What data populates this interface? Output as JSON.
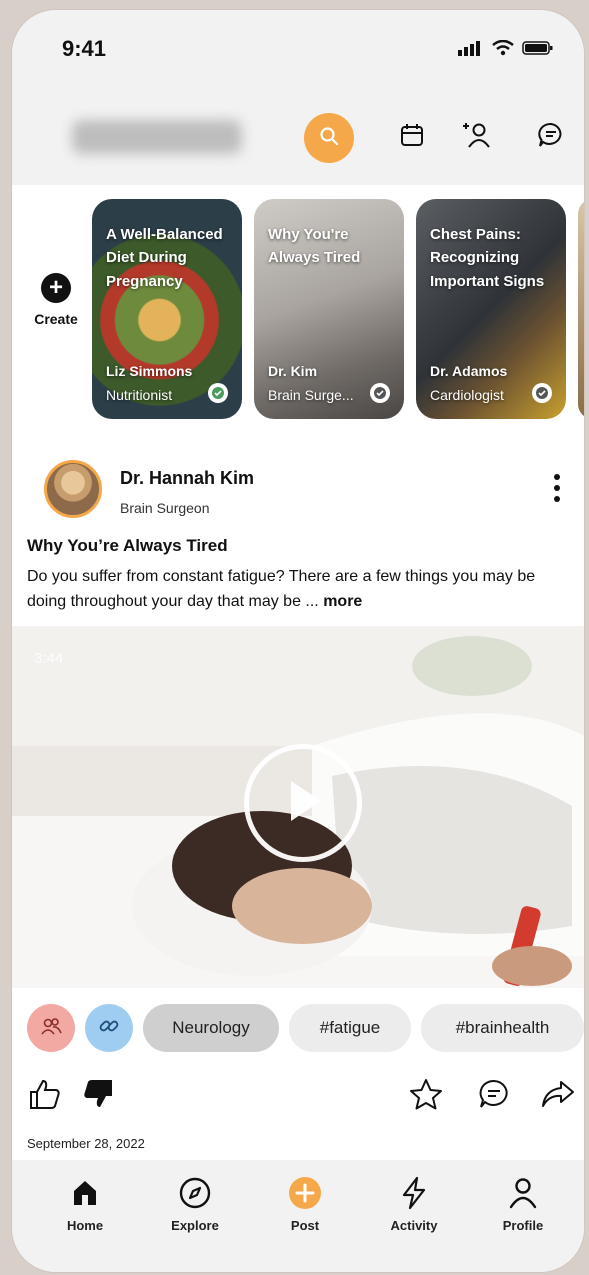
{
  "status_bar": {
    "time": "9:41"
  },
  "header": {
    "search_color": "#f5a84a",
    "icons": [
      "search-icon",
      "calendar-icon",
      "add-user-icon",
      "chat-icon"
    ]
  },
  "stories": {
    "create_label": "Create",
    "items": [
      {
        "title": "A Well-Balanced Diet During Pregnancy",
        "name": "Liz Simmons",
        "role": "Nutritionist"
      },
      {
        "title": "Why You're Always Tired",
        "name": "Dr. Kim",
        "role": "Brain Surge..."
      },
      {
        "title": "Chest Pains: Recognizing Important Signs",
        "name": "Dr. Adamos",
        "role": "Cardiologist"
      }
    ]
  },
  "post": {
    "author": "Dr. Hannah Kim",
    "author_role": "Brain Surgeon",
    "title": "Why You’re Always Tired",
    "body": "Do you suffer from constant fatigue? There are a few things you may be doing throughout your day that may be ... ",
    "more_label": "more",
    "video_duration": "3:44",
    "tags": [
      "Neurology",
      "#fatigue",
      "#brainhealth"
    ],
    "date": "September 28, 2022"
  },
  "colors": {
    "accent": "#f5a84a",
    "tag_group_bg": "#f2a8a3",
    "tag_link_bg": "#9fcdf2",
    "tag_active_bg": "#cfcfcf",
    "tag_bg": "#ececec"
  },
  "tabbar": {
    "items": [
      {
        "label": "Home",
        "icon": "home-icon"
      },
      {
        "label": "Explore",
        "icon": "compass-icon"
      },
      {
        "label": "Post",
        "icon": "plus-circle-icon"
      },
      {
        "label": "Activity",
        "icon": "lightning-icon"
      },
      {
        "label": "Profile",
        "icon": "person-icon"
      }
    ]
  }
}
